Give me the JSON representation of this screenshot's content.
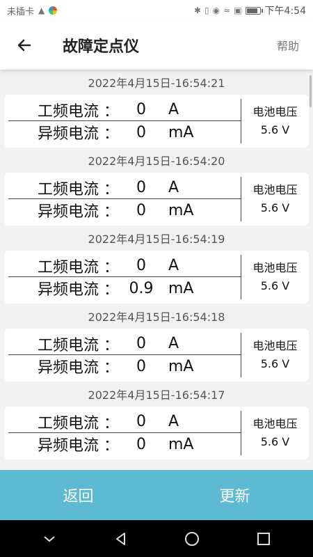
{
  "status_bar": {
    "carrier": "未插卡",
    "time": "下午4:54"
  },
  "app_bar": {
    "title": "故障定点仪",
    "help": "帮助"
  },
  "records": [
    {
      "timestamp": "2022年4月15日-16:54:21",
      "power_label": "工频电流",
      "colon": "：",
      "power_value": "0",
      "power_unit": "A",
      "abnormal_label": "异频电流",
      "abnormal_value": "0",
      "abnormal_unit": "mA",
      "battery_label": "电池电压",
      "battery_value": "5.6 V"
    },
    {
      "timestamp": "2022年4月15日-16:54:20",
      "power_label": "工频电流",
      "colon": "：",
      "power_value": "0",
      "power_unit": "A",
      "abnormal_label": "异频电流",
      "abnormal_value": "0",
      "abnormal_unit": "mA",
      "battery_label": "电池电压",
      "battery_value": "5.6 V"
    },
    {
      "timestamp": "2022年4月15日-16:54:19",
      "power_label": "工频电流",
      "colon": "：",
      "power_value": "0",
      "power_unit": "A",
      "abnormal_label": "异频电流",
      "abnormal_value": "0.9",
      "abnormal_unit": "mA",
      "battery_label": "电池电压",
      "battery_value": "5.6 V"
    },
    {
      "timestamp": "2022年4月15日-16:54:18",
      "power_label": "工频电流",
      "colon": "：",
      "power_value": "0",
      "power_unit": "A",
      "abnormal_label": "异频电流",
      "abnormal_value": "0",
      "abnormal_unit": "mA",
      "battery_label": "电池电压",
      "battery_value": "5.6 V"
    },
    {
      "timestamp": "2022年4月15日-16:54:17",
      "power_label": "工频电流",
      "colon": "：",
      "power_value": "0",
      "power_unit": "A",
      "abnormal_label": "异频电流",
      "abnormal_value": "0",
      "abnormal_unit": "mA",
      "battery_label": "电池电压",
      "battery_value": "5.6 V"
    }
  ],
  "bottom_bar": {
    "back": "返回",
    "refresh": "更新"
  },
  "colors": {
    "accent": "#5cbad3",
    "background": "#f2f2f2"
  },
  "icons": {
    "back": "arrow-left-icon",
    "nav_down": "chevron-down-icon",
    "nav_back": "triangle-back-icon",
    "nav_home": "circle-home-icon",
    "nav_recents": "square-recents-icon"
  }
}
